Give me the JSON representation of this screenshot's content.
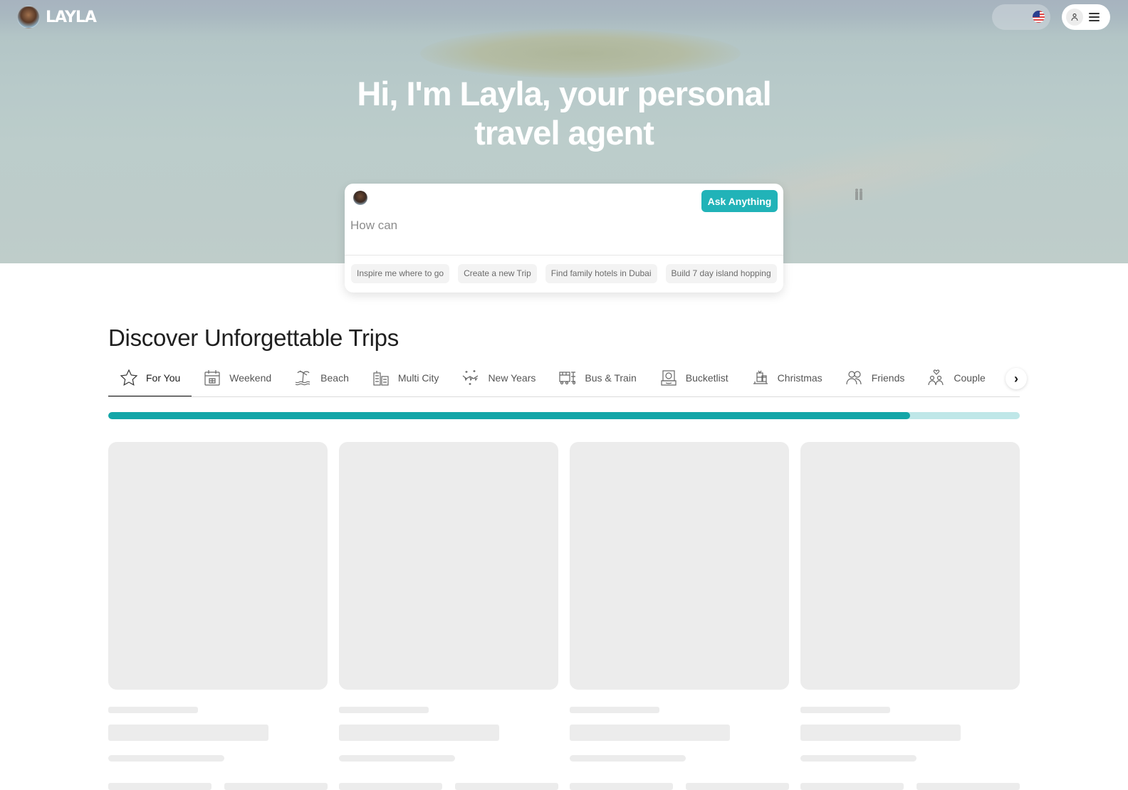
{
  "header": {
    "logo_text": "LAYLA",
    "language_flag": "us-flag-icon",
    "account_icon": "user-icon",
    "menu_icon": "hamburger-icon"
  },
  "hero": {
    "headline_line1": "Hi, I'm Layla, your personal",
    "headline_line2": "travel agent"
  },
  "ask": {
    "button_label": "Ask Anything",
    "input_placeholder": "How can",
    "suggestions": [
      "Inspire me where to go",
      "Create a new Trip",
      "Find family hotels in Dubai",
      "Build 7 day island hopping"
    ]
  },
  "discover": {
    "title": "Discover Unforgettable Trips",
    "tabs": [
      {
        "label": "For You",
        "icon": "star-icon",
        "active": true
      },
      {
        "label": "Weekend",
        "icon": "calendar-icon"
      },
      {
        "label": "Beach",
        "icon": "palm-tree-icon"
      },
      {
        "label": "Multi City",
        "icon": "buildings-icon"
      },
      {
        "label": "New Years",
        "icon": "celebration-icon"
      },
      {
        "label": "Bus & Train",
        "icon": "train-icon"
      },
      {
        "label": "Bucketlist",
        "icon": "bucketlist-icon"
      },
      {
        "label": "Christmas",
        "icon": "sleigh-icon"
      },
      {
        "label": "Friends",
        "icon": "friends-icon"
      },
      {
        "label": "Couple",
        "icon": "couple-icon"
      },
      {
        "label": "",
        "icon": "person-icon"
      }
    ],
    "next_label": "›",
    "loading_progress": 0.88,
    "colors": {
      "accent": "#13a6a8",
      "accent_light": "#bfe7e8",
      "button": "#21b3b8"
    }
  }
}
